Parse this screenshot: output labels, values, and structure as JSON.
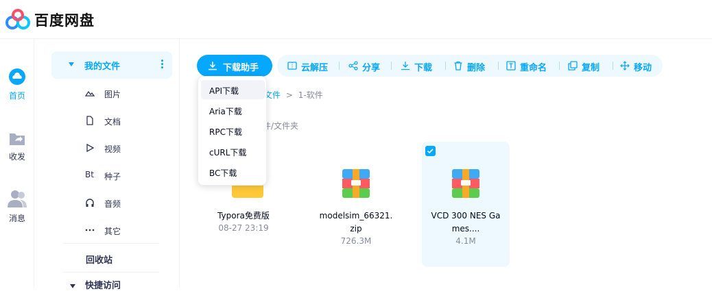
{
  "app": {
    "brand": "百度网盘"
  },
  "leftnav": [
    {
      "label": "首页",
      "icon": "cloud-icon",
      "active": true
    },
    {
      "label": "收发",
      "icon": "share-folder-icon",
      "active": false
    },
    {
      "label": "消息",
      "icon": "contacts-icon",
      "active": false
    }
  ],
  "sidebar": {
    "myfiles": "我的文件",
    "items": [
      {
        "label": "图片",
        "icon": "image-icon"
      },
      {
        "label": "文档",
        "icon": "document-icon"
      },
      {
        "label": "视频",
        "icon": "video-icon"
      },
      {
        "label": "种子",
        "icon": "bt-icon",
        "glyph": "Bt"
      },
      {
        "label": "音频",
        "icon": "headphone-icon"
      },
      {
        "label": "其它",
        "icon": "ellipsis-icon"
      }
    ],
    "recycle": "回收站",
    "quick_access": "快捷访问"
  },
  "toolbar": {
    "download_helper": "下载助手",
    "actions": [
      {
        "label": "云解压",
        "icon": "unzip-icon"
      },
      {
        "label": "分享",
        "icon": "share-icon"
      },
      {
        "label": "下载",
        "icon": "download-icon"
      },
      {
        "label": "删除",
        "icon": "trash-icon"
      },
      {
        "label": "重命名",
        "icon": "rename-icon"
      },
      {
        "label": "复制",
        "icon": "copy-icon"
      },
      {
        "label": "移动",
        "icon": "move-icon"
      }
    ]
  },
  "dropdown": {
    "items": [
      "API下载",
      "Aria下载",
      "RPC下载",
      "cURL下载",
      "BC下载"
    ],
    "hovered": "API下载"
  },
  "breadcrumb": {
    "parent_partial": "文件",
    "sep": ">",
    "current": "1-软件"
  },
  "count_text": "件/文件夹",
  "files": [
    {
      "name": "Typora免费版",
      "meta": "08-27 23:19",
      "type": "folder",
      "selected": false
    },
    {
      "name": "modelsim_66321.\nzip",
      "meta": "726.3M",
      "type": "zip",
      "selected": false
    },
    {
      "name": "VCD 300 NES Ga\nmes....",
      "meta": "4.1M",
      "type": "zip",
      "selected": true
    }
  ],
  "colors": {
    "accent": "#06a7ff",
    "accent_light": "#eef8ff"
  }
}
